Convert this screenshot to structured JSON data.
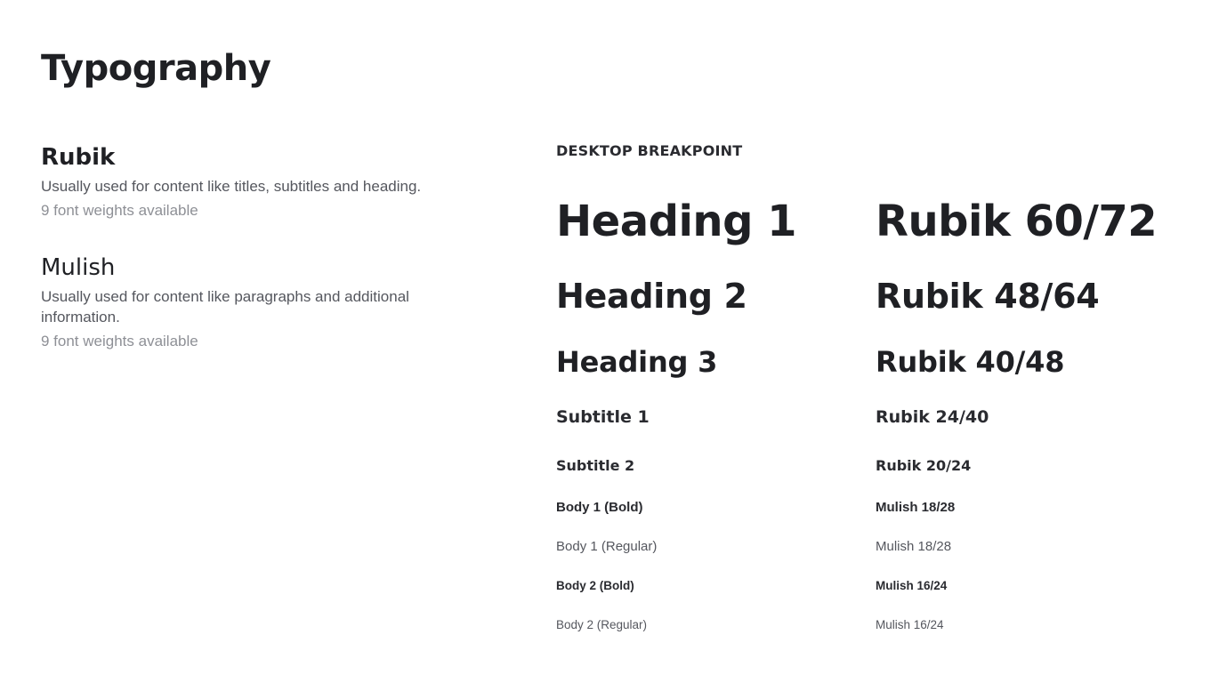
{
  "page": {
    "title": "Typography"
  },
  "fonts": [
    {
      "name": "Rubik",
      "description": "Usually used for content like titles, subtitles and heading.",
      "weights": "9 font weights available"
    },
    {
      "name": "Mulish",
      "description": "Usually used for content like paragraphs and additional information.",
      "weights": "9 font weights available"
    }
  ],
  "breakpoint": {
    "label": "DESKTOP BREAKPOINT",
    "styles": [
      {
        "name": "Heading 1",
        "spec": "Rubik 60/72"
      },
      {
        "name": "Heading 2",
        "spec": "Rubik 48/64"
      },
      {
        "name": "Heading 3",
        "spec": "Rubik 40/48"
      },
      {
        "name": "Subtitle 1",
        "spec": "Rubik 24/40"
      },
      {
        "name": "Subtitle 2",
        "spec": "Rubik 20/24"
      },
      {
        "name": "Body 1 (Bold)",
        "spec": "Mulish 18/28"
      },
      {
        "name": "Body 1 (Regular)",
        "spec": "Mulish 18/28"
      },
      {
        "name": "Body 2 (Bold)",
        "spec": "Mulish 16/24"
      },
      {
        "name": "Body 2 (Regular)",
        "spec": "Mulish 16/24"
      }
    ]
  },
  "colors": {
    "text_primary": "#1f2024",
    "text_secondary": "#55575e",
    "text_muted": "#8e9096",
    "background": "#ffffff"
  }
}
